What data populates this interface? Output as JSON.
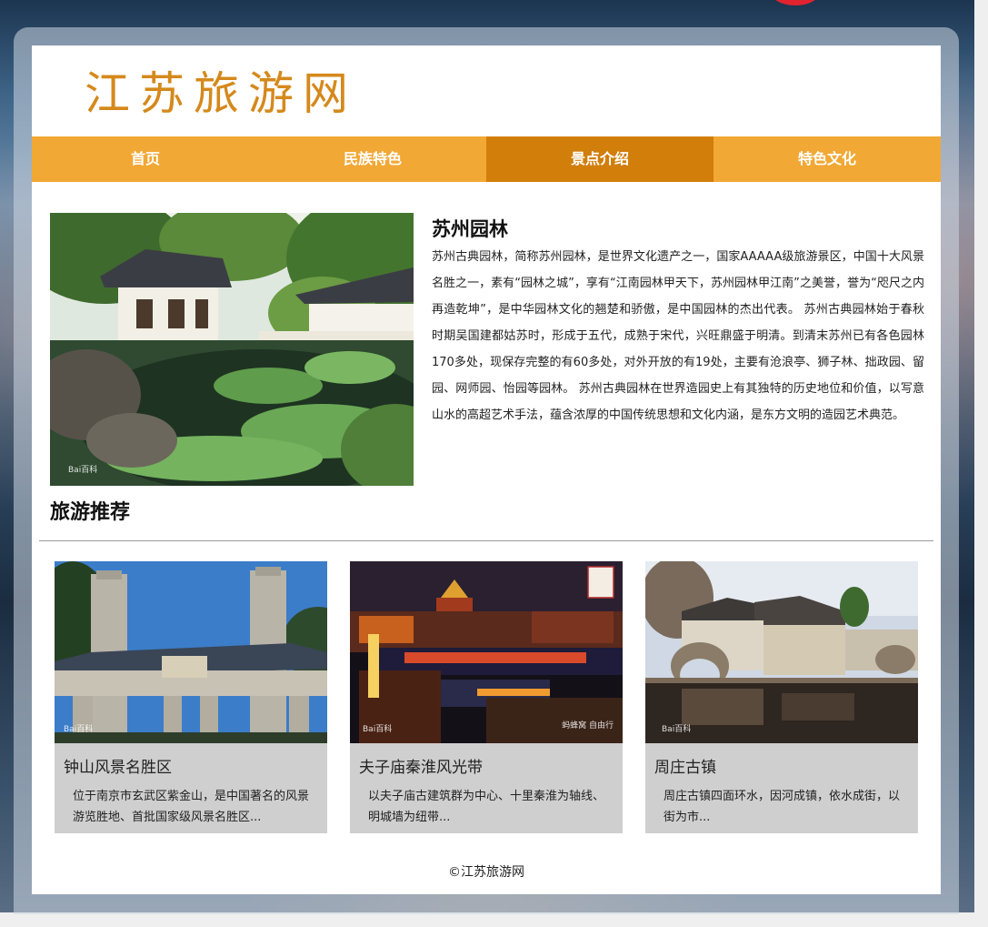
{
  "site": {
    "logo": "江苏旅游网"
  },
  "nav": [
    {
      "label": "首页",
      "active": false
    },
    {
      "label": "民族特色",
      "active": false
    },
    {
      "label": "景点介绍",
      "active": true
    },
    {
      "label": "特色文化",
      "active": false
    }
  ],
  "feature": {
    "title": "苏州园林",
    "text": "苏州古典园林，简称苏州园林，是世界文化遗产之一，国家AAAAA级旅游景区，中国十大风景名胜之一，素有“园林之城”，享有“江南园林甲天下，苏州园林甲江南”之美誉，誉为“咫尺之内再造乾坤”，是中华园林文化的翘楚和骄傲，是中国园林的杰出代表。 苏州古典园林始于春秋时期吴国建都姑苏时，形成于五代，成熟于宋代，兴旺鼎盛于明清。到清末苏州已有各色园林170多处，现保存完整的有60多处，对外开放的有19处，主要有沧浪亭、狮子林、拙政园、留园、网师园、怡园等园林。 苏州古典园林在世界造园史上有其独特的历史地位和价值，以写意山水的高超艺术手法，蕴含浓厚的中国传统思想和文化内涵，是东方文明的造园艺术典范。",
    "watermark": "Bai百科"
  },
  "recommend": {
    "title": "旅游推荐",
    "cards": [
      {
        "title": "钟山风景名胜区",
        "desc": "位于南京市玄武区紫金山，是中国著名的风景游览胜地、首批国家级风景名胜区...",
        "watermark": "Bai百科"
      },
      {
        "title": "夫子庙秦淮风光带",
        "desc": "以夫子庙古建筑群为中心、十里秦淮为轴线、明城墙为纽带...",
        "watermark": "Bai百科",
        "watermark2": "蚂蜂窝 自由行"
      },
      {
        "title": "周庄古镇",
        "desc": "周庄古镇四面环水，因河成镇，依水成街，以街为市...",
        "watermark": "Bai百科"
      }
    ]
  },
  "footer": {
    "copyright": "©江苏旅游网"
  },
  "colors": {
    "nav_bg": "#f2a834",
    "nav_active": "#d27e0b",
    "logo": "#d5891c",
    "card_bg": "#cfcfcf"
  }
}
